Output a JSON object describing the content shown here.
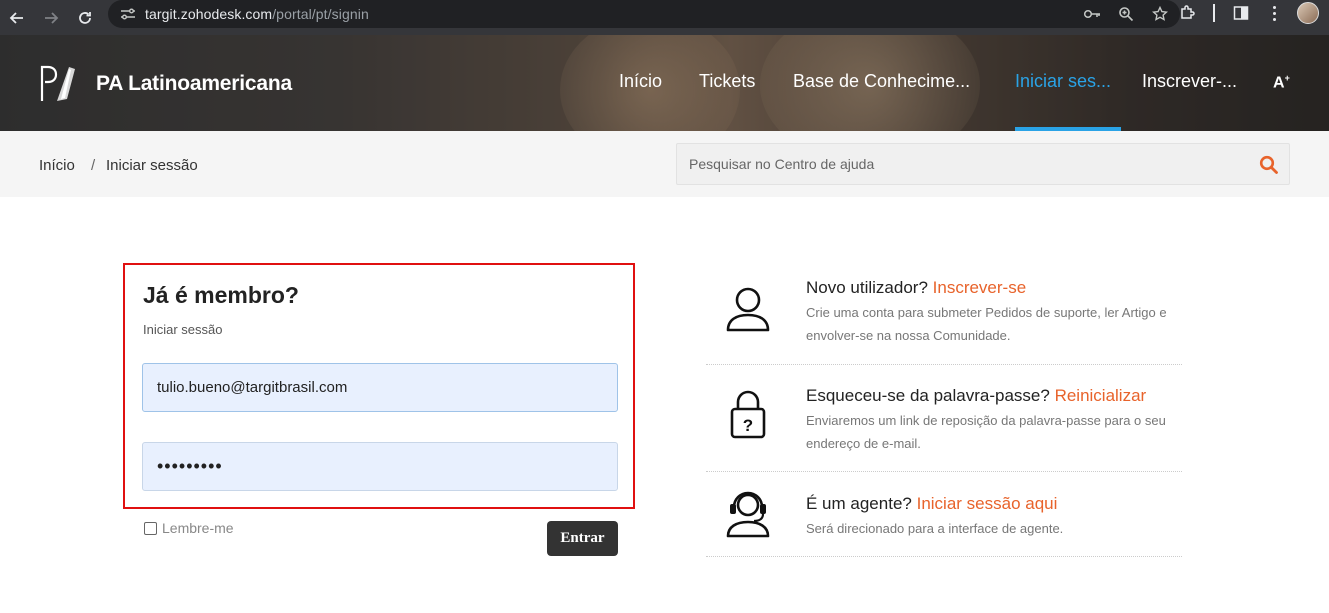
{
  "browser": {
    "url_host": "targit.zohodesk.com",
    "url_path": "/portal/pt/signin"
  },
  "header": {
    "brand": "PA Latinoamericana",
    "nav": [
      {
        "label": "Início",
        "active": false
      },
      {
        "label": "Tickets",
        "active": false
      },
      {
        "label": "Base de Conhecime...",
        "active": false
      },
      {
        "label": "Iniciar ses...",
        "active": true
      },
      {
        "label": "Inscrever-...",
        "active": false
      }
    ],
    "font_size_icon": "A"
  },
  "breadcrumb": {
    "home": "Início",
    "separator": "/",
    "current": "Iniciar sessão"
  },
  "search": {
    "placeholder": "Pesquisar no Centro de ajuda"
  },
  "login": {
    "title": "Já é membro?",
    "subtitle": "Iniciar sessão",
    "email_value": "tulio.bueno@targitbrasil.com",
    "password_value": "•••••••••",
    "remember_label": "Lembre-me",
    "submit_label": "Entrar"
  },
  "options": [
    {
      "icon": "user-icon",
      "question": "Novo utilizador?",
      "link": "Inscrever-se",
      "description": "Crie uma conta para submeter Pedidos de suporte, ler Artigo e envolver-se na nossa Comunidade."
    },
    {
      "icon": "lock-question-icon",
      "question": "Esqueceu-se da palavra-passe?",
      "link": "Reinicializar",
      "description": "Enviaremos um link de reposição da palavra-passe para o seu endereço de e-mail."
    },
    {
      "icon": "agent-headset-icon",
      "question": "É um agente?",
      "link": "Iniciar sessão aqui",
      "description": "Será direcionado para a interface de agente."
    }
  ],
  "colors": {
    "accent_link": "#e8632b",
    "nav_active": "#2aa3e6",
    "highlight_border": "#e01010",
    "button_bg": "#333333"
  }
}
